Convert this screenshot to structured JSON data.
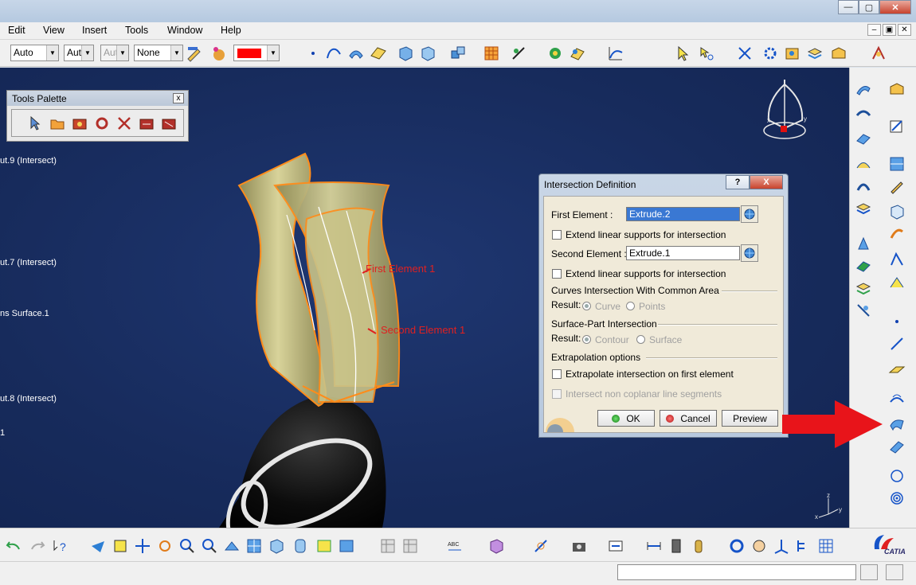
{
  "menubar": {
    "items": [
      "Edit",
      "View",
      "Insert",
      "Tools",
      "Window",
      "Help"
    ]
  },
  "toolbar": {
    "combo1": "Auto",
    "combo2": "Aut",
    "combo3": "Aut",
    "combo4": "None",
    "color": "#ff0000"
  },
  "palette": {
    "title": "Tools Palette",
    "close": "x"
  },
  "tree": {
    "items": [
      "ut.9 (Intersect)",
      "ut.7 (Intersect)",
      "ns Surface.1",
      "ut.8 (Intersect)",
      "1"
    ]
  },
  "annotations": {
    "first": "First Element 1",
    "second": "Second Element 1"
  },
  "dialog": {
    "title": "Intersection Definition",
    "help": "?",
    "close": "X",
    "first_label": "First Element :",
    "first_value": "Extrude.2",
    "extend1": "Extend linear supports for intersection",
    "second_label": "Second Element :",
    "second_value": "Extrude.1",
    "extend2": "Extend linear supports for intersection",
    "curves_section": "Curves Intersection With Common Area",
    "result_label": "Result:",
    "curve_opt": "Curve",
    "points_opt": "Points",
    "surface_section": "Surface-Part Intersection",
    "result_label2": "Result:",
    "contour_opt": "Contour",
    "surface_opt": "Surface",
    "extrap_section": "Extrapolation options",
    "extrap_first": "Extrapolate intersection on first element",
    "non_coplanar": "Intersect non coplanar line segments",
    "ok": "OK",
    "cancel": "Cancel",
    "preview": "Preview"
  },
  "compass": {
    "x": "x",
    "y": "y",
    "z": "z"
  },
  "brand": {
    "logo": "CATIA"
  },
  "colors": {
    "viewport": "#172b5c",
    "surface": "#b8b177",
    "edge": "#ff8c1a",
    "annotation": "#e02020",
    "arrow": "#e8141a"
  }
}
